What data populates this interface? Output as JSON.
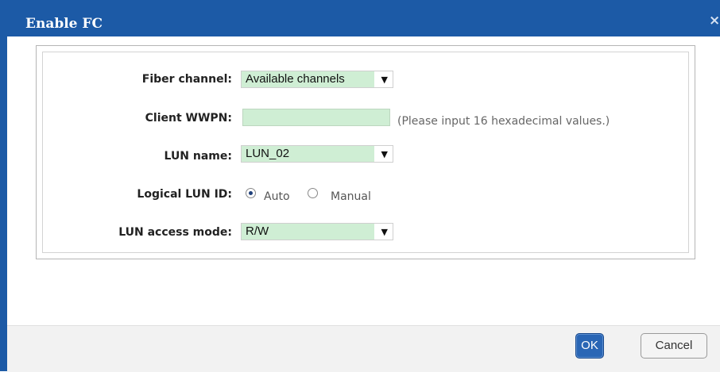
{
  "dialog": {
    "title": "Enable FC",
    "close_glyph": "×"
  },
  "form": {
    "fiber_channel": {
      "label": "Fiber channel:",
      "value": "Available channels"
    },
    "client_wwpn": {
      "label": "Client WWPN:",
      "value": "",
      "hint": "(Please input 16 hexadecimal values.)"
    },
    "lun_name": {
      "label": "LUN name:",
      "value": "LUN_02"
    },
    "logical_lun_id": {
      "label": "Logical LUN ID:",
      "options": [
        {
          "label": "Auto",
          "selected": true
        },
        {
          "label": "Manual",
          "selected": false
        }
      ]
    },
    "lun_access_mode": {
      "label": "LUN access mode:",
      "value": "R/W"
    }
  },
  "footer": {
    "ok_label": "OK",
    "cancel_label": "Cancel"
  },
  "icons": {
    "dropdown_arrow": "▼",
    "close": "close-icon"
  },
  "colors": {
    "title_bar": "#1c5aa6",
    "field_bg": "#cfeed4",
    "ok_button": "#2a66b5"
  }
}
